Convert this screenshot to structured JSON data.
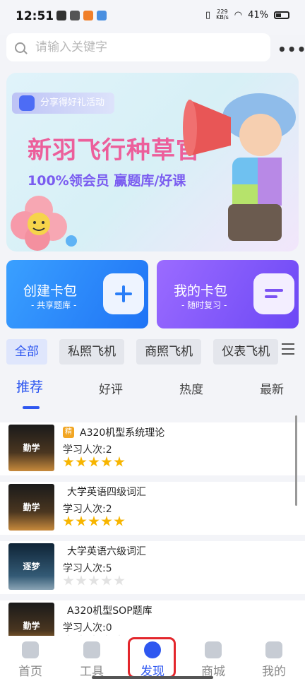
{
  "status_bar": {
    "time": "12:51",
    "net_speed_top": "229",
    "net_speed_bottom": "KB/s",
    "battery": "41%"
  },
  "search": {
    "placeholder": "请输入关键字",
    "more": "•••"
  },
  "banner": {
    "tag": "分享得好礼活动",
    "title": "新羽飞行种草官",
    "subtitle": "100%领会员 赢题库/好课"
  },
  "cards": [
    {
      "title": "创建卡包",
      "subtitle": "- 共享题库 -",
      "icon": "plus-icon"
    },
    {
      "title": "我的卡包",
      "subtitle": "- 随时复习 -",
      "icon": "card-list-icon"
    }
  ],
  "categories": [
    "全部",
    "私照飞机",
    "商照飞机",
    "仪表飞机"
  ],
  "tabs": [
    "推荐",
    "好评",
    "热度",
    "最新"
  ],
  "list": [
    {
      "name": "A320机型系统理论",
      "badge": "精",
      "count": "学习人次:2",
      "rating": 5,
      "thumb_text": "勤学"
    },
    {
      "name": "大学英语四级词汇",
      "count": "学习人次:2",
      "rating": 5,
      "thumb_text": "勤学"
    },
    {
      "name": "大学英语六级词汇",
      "count": "学习人次:5",
      "rating": 0,
      "thumb_text": "逐梦"
    },
    {
      "name": "A320机型SOP题库",
      "count": "学习人次:0",
      "rating": 0,
      "thumb_text": "勤学"
    }
  ],
  "bottom_nav": [
    "首页",
    "工具",
    "发现",
    "商城",
    "我的"
  ],
  "colors": {
    "accent": "#2e57f0",
    "star": "#f7b500",
    "highlight": "#e3262c"
  }
}
